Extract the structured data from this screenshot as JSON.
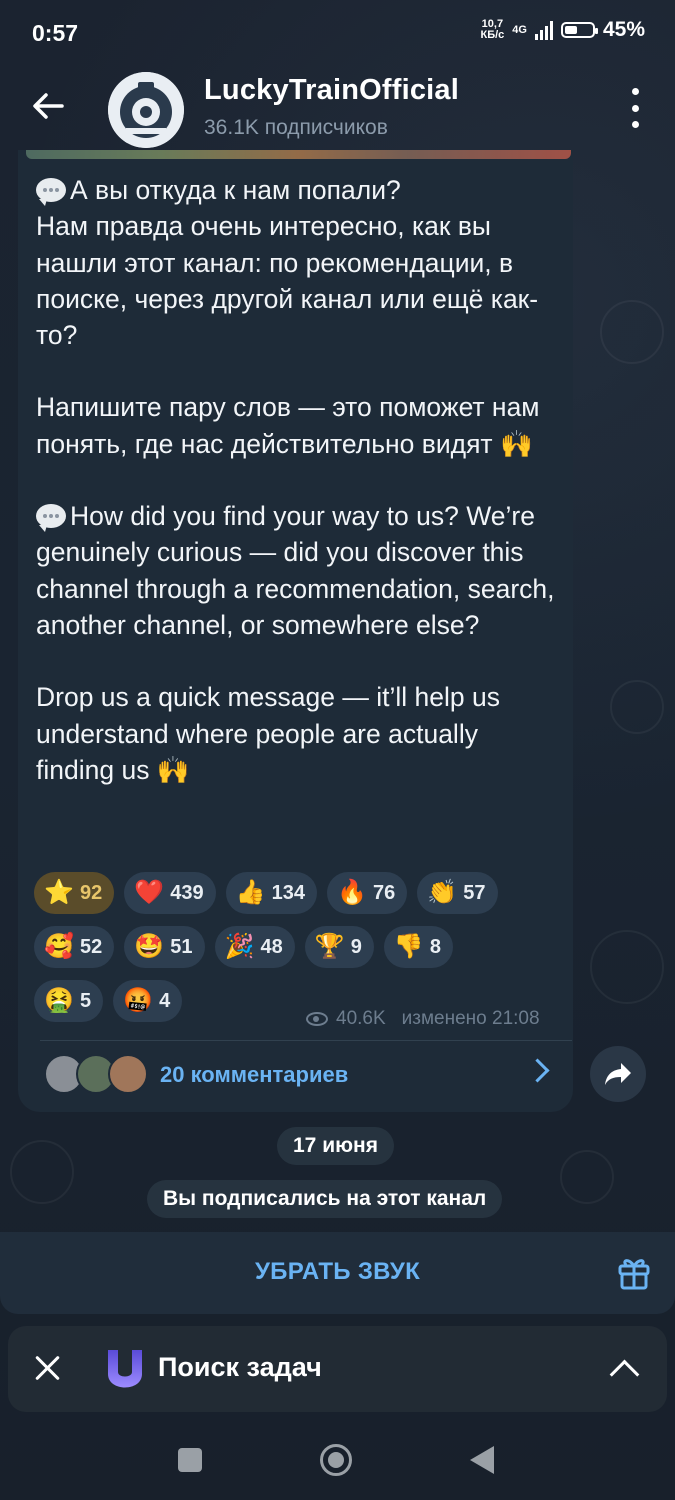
{
  "status_bar": {
    "time": "0:57",
    "net_speed_top": "10,7",
    "net_speed_bottom": "КБ/с",
    "network": "4G",
    "battery": "45%",
    "battery_level": 0.45
  },
  "header": {
    "title": "LuckyTrainOfficial",
    "subtitle": "36.1K подписчиков"
  },
  "message": {
    "paragraphs": [
      "А вы откуда к нам попали?\nНам правда очень интересно, как вы нашли этот канал: по рекомендации, в поиске, через другой канал или ещё как-то?",
      "Напишите пару слов — это поможет нам понять, где нас действительно видят",
      "How did you find your way to us? We’re genuinely curious — did you discover this channel through a recommendation, search, another channel, or somewhere else?",
      "Drop us a quick message — it’ll help us understand where people are actually finding us"
    ],
    "raised_hands": "🙌",
    "views": "40.6K",
    "edited_time": "изменено 21:08",
    "comments_label": "20 комментариев"
  },
  "reactions": [
    [
      {
        "icon": "⭐",
        "count": "92"
      },
      {
        "icon": "❤️",
        "count": "439"
      },
      {
        "icon": "👍",
        "count": "134"
      },
      {
        "icon": "🔥",
        "count": "76"
      },
      {
        "icon": "👏",
        "count": "57"
      }
    ],
    [
      {
        "icon": "🥰",
        "count": "52"
      },
      {
        "icon": "🤩",
        "count": "51"
      },
      {
        "icon": "🎉",
        "count": "48"
      },
      {
        "icon": "🏆",
        "count": "9"
      },
      {
        "icon": "👎",
        "count": "8"
      }
    ],
    [
      {
        "icon": "🤮",
        "count": "5"
      },
      {
        "icon": "🤬",
        "count": "4"
      }
    ]
  ],
  "date_pill": "17 июня",
  "service_message": "Вы подписались на этот канал",
  "mute_button": "УБРАТЬ ЗВУК",
  "task_bar": {
    "label": "Поиск задач"
  },
  "colors": {
    "accent": "#6ab3f3",
    "bubble": "#1e2b38",
    "background": "#1a2431"
  }
}
